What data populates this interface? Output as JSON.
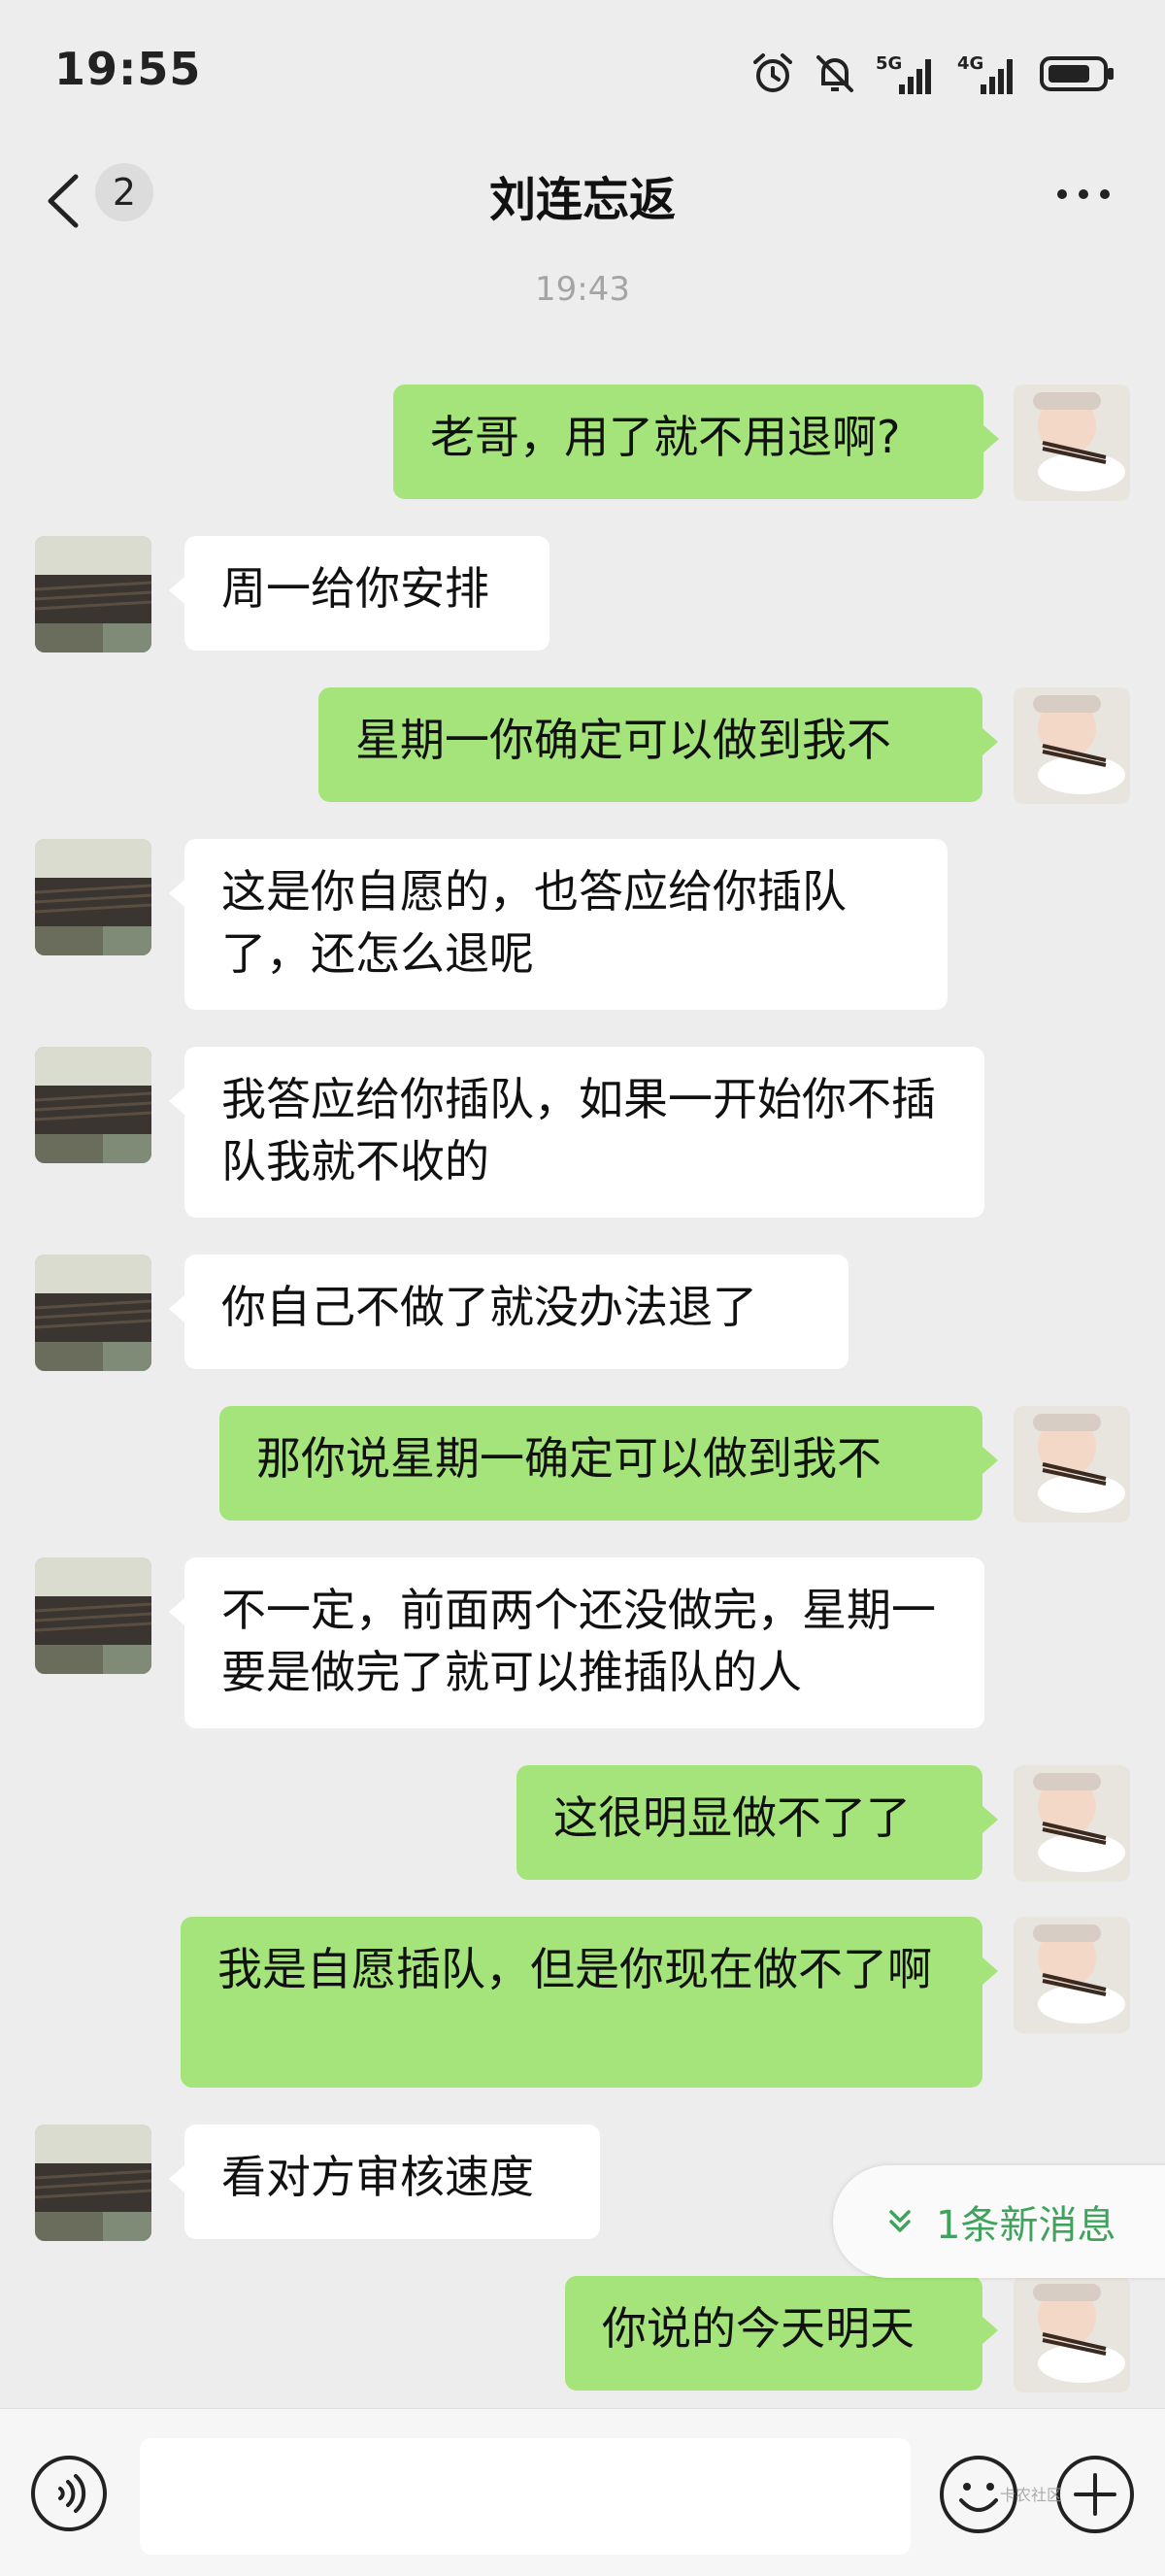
{
  "status_bar": {
    "time": "19:55",
    "network_1": "5G",
    "network_2": "4G"
  },
  "nav": {
    "unread_count": "2",
    "title": "刘连忘返"
  },
  "timestamp": "19:43",
  "messages": [
    {
      "side": "out",
      "text": "老哥，用了就不用退啊?"
    },
    {
      "side": "in",
      "text": "周一给你安排"
    },
    {
      "side": "out",
      "text": "星期一你确定可以做到我不"
    },
    {
      "side": "in",
      "text": "这是你自愿的，也答应给你插队了，还怎么退呢"
    },
    {
      "side": "in",
      "text": "我答应给你插队，如果一开始你不插队我就不收的"
    },
    {
      "side": "in",
      "text": "你自己不做了就没办法退了"
    },
    {
      "side": "out",
      "text": "那你说星期一确定可以做到我不"
    },
    {
      "side": "in",
      "text": "不一定，前面两个还没做完，星期一要是做完了就可以推插队的人"
    },
    {
      "side": "out",
      "text": "这很明显做不了了"
    },
    {
      "side": "out",
      "text": "我是自愿插队，但是你现在做不了啊"
    },
    {
      "side": "in",
      "text": "看对方审核速度"
    },
    {
      "side": "out",
      "text": "你说的今天明天"
    }
  ],
  "new_messages": {
    "label": "1条新消息"
  },
  "watermark": "卡农社区",
  "colors": {
    "background": "#ededed",
    "outgoing_bubble": "#a5e47a",
    "incoming_bubble": "#ffffff",
    "new_msg_text": "#3fa35c"
  }
}
